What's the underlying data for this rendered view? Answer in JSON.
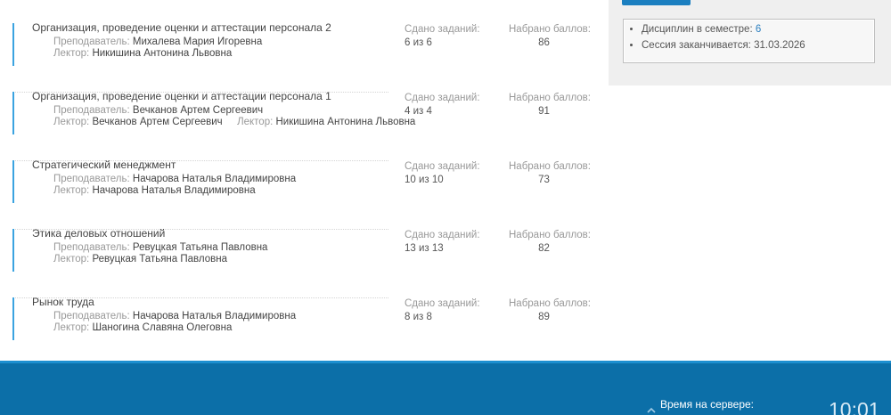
{
  "courses": [
    {
      "title": "Организация, проведение оценки и аттестации персонала 2",
      "teacher_label": "Преподаватель:",
      "teacher": "Михалева Мария Игоревна",
      "lecturer_label": "Лектор:",
      "lecturer": "Никишина Антонина Львовна",
      "lecturer2_label": "",
      "lecturer2": "",
      "tasks_label": "Сдано заданий:",
      "tasks": "6 из 6",
      "points_label": "Набрано баллов:",
      "points": "86"
    },
    {
      "title": "Организация, проведение оценки и аттестации персонала 1",
      "teacher_label": "Преподаватель:",
      "teacher": "Вечканов Артем Сергеевич",
      "lecturer_label": "Лектор:",
      "lecturer": "Вечканов Артем Сергеевич",
      "lecturer2_label": "Лектор:",
      "lecturer2": "Никишина Антонина Львовна",
      "tasks_label": "Сдано заданий:",
      "tasks": "4 из 4",
      "points_label": "Набрано баллов:",
      "points": "91"
    },
    {
      "title": "Стратегический менеджмент",
      "teacher_label": "Преподаватель:",
      "teacher": "Начарова Наталья Владимировна",
      "lecturer_label": "Лектор:",
      "lecturer": "Начарова Наталья Владимировна",
      "lecturer2_label": "",
      "lecturer2": "",
      "tasks_label": "Сдано заданий:",
      "tasks": "10 из 10",
      "points_label": "Набрано баллов:",
      "points": "73"
    },
    {
      "title": "Этика деловых отношений",
      "teacher_label": "Преподаватель:",
      "teacher": "Ревуцкая Татьяна Павловна",
      "lecturer_label": "Лектор:",
      "lecturer": "Ревуцкая Татьяна Павловна",
      "lecturer2_label": "",
      "lecturer2": "",
      "tasks_label": "Сдано заданий:",
      "tasks": "13 из 13",
      "points_label": "Набрано баллов:",
      "points": "82"
    },
    {
      "title": "Рынок труда",
      "teacher_label": "Преподаватель:",
      "teacher": "Начарова Наталья Владимировна",
      "lecturer_label": "Лектор:",
      "lecturer": "Шаногина Славяна Олеговна",
      "lecturer2_label": "",
      "lecturer2": "",
      "tasks_label": "Сдано заданий:",
      "tasks": "8 из 8",
      "points_label": "Набрано баллов:",
      "points": "89"
    }
  ],
  "sidebar": {
    "disciplines_label": "Дисциплин в семестре:",
    "disciplines_count": "6",
    "session_label": "Сессия заканчивается:",
    "session_end": "31.03.2026"
  },
  "footer": {
    "server_time_label": "Время на сервере:",
    "server_time": "10:01",
    "icon": "clock-icon"
  },
  "colors": {
    "accent": "#3aa3e0",
    "button": "#1b7fc0",
    "footer": "#0c6fa8"
  }
}
